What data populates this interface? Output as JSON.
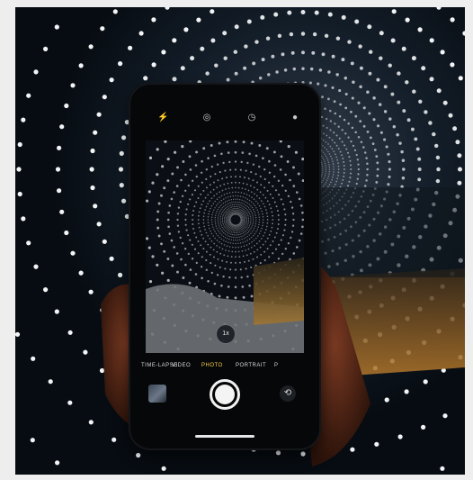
{
  "photo": {
    "description_icons": {
      "flash": "flash-icon",
      "live": "live-photo-icon",
      "timer": "timer-icon",
      "filters": "filters-icon"
    }
  },
  "camera": {
    "zoom_label": "1x",
    "modes": [
      "TIME-LAPSE",
      "VIDEO",
      "PHOTO",
      "PORTRAIT",
      "P"
    ],
    "active_mode": "PHOTO"
  },
  "colors": {
    "background": "#eeeeee",
    "scene_dark": "#0a121b",
    "light_dot": "#f2f4f6",
    "warm_floor": "#a06a28",
    "active_mode": "#ffd24a"
  }
}
